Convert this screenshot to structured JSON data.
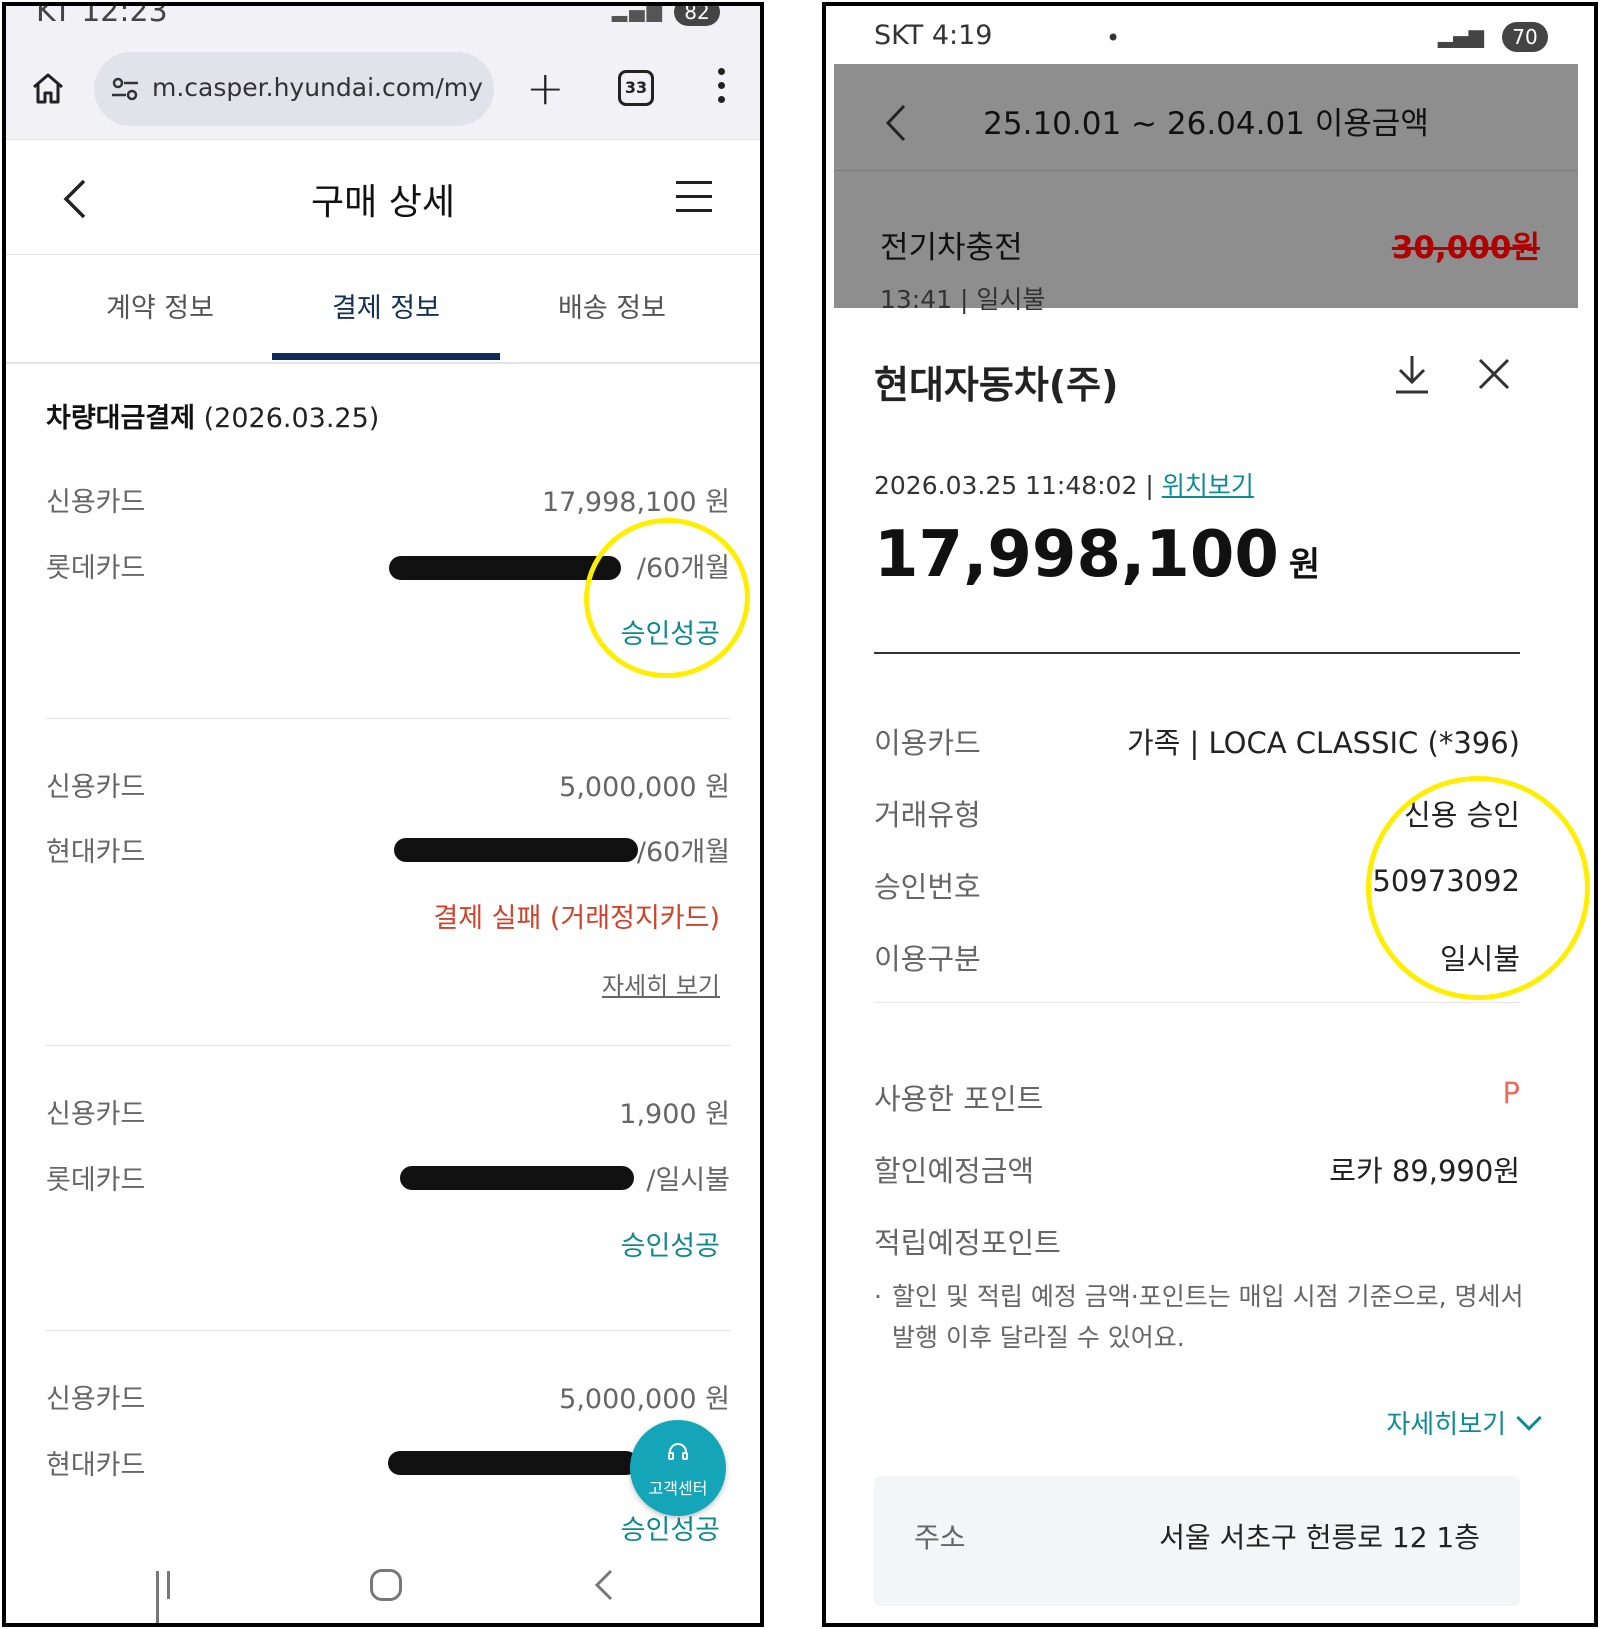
{
  "left": {
    "status": {
      "time": "KT 12:23",
      "battery": "82"
    },
    "browser": {
      "url": "m.casper.hyundai.com/mypag",
      "tab_count": "33"
    },
    "header": {
      "title": "구매 상세"
    },
    "tabs": [
      {
        "label": "계약 정보",
        "active": false
      },
      {
        "label": "결제 정보",
        "active": true
      },
      {
        "label": "배송 정보",
        "active": false
      }
    ],
    "section": {
      "title": "차량대금결제",
      "date": "(2026.03.25)"
    },
    "payments": [
      {
        "method": "신용카드",
        "amount": "17,998,100 원",
        "card": "롯데카드",
        "installment": "/60개월",
        "status": "승인성공",
        "status_type": "ok"
      },
      {
        "method": "신용카드",
        "amount": "5,000,000 원",
        "card": "현대카드",
        "installment": "/60개월",
        "status": "결제 실패 (거래정지카드)",
        "status_type": "fail",
        "detail_link": "자세히 보기"
      },
      {
        "method": "신용카드",
        "amount": "1,900 원",
        "card": "롯데카드",
        "installment": "/일시불",
        "status": "승인성공",
        "status_type": "ok"
      },
      {
        "method": "신용카드",
        "amount": "5,000,000 원",
        "card": "현대카드",
        "installment": "",
        "status": "승인성공",
        "status_type": "ok"
      }
    ],
    "fab": {
      "label": "고객센터"
    }
  },
  "right": {
    "status": {
      "carrier_time": "SKT 4:19",
      "battery": "70"
    },
    "overlay": {
      "title": "25.10.01 ~ 26.04.01 이용금액",
      "merchant": "전기차충전",
      "amount": "30,000원",
      "time": "13:41",
      "type": "일시불"
    },
    "detail": {
      "merchant": "현대자동차(주)",
      "datetime": "2026.03.25 11:48:02",
      "location_link": "위치보기",
      "amount": "17,998,100",
      "unit": "원",
      "rows": [
        {
          "label": "이용카드",
          "value": "가족 | LOCA CLASSIC (*396)"
        },
        {
          "label": "거래유형",
          "value": "신용 승인"
        },
        {
          "label": "승인번호",
          "value": "50973092"
        },
        {
          "label": "이용구분",
          "value": "일시불"
        }
      ],
      "rows2": [
        {
          "label": "사용한 포인트",
          "value": "P"
        },
        {
          "label": "할인예정금액",
          "value": "로카 89,990원"
        },
        {
          "label": "적립예정포인트",
          "value": ""
        }
      ],
      "note": "할인 및 적립 예정 금액·포인트는 매입 시점 기준으로, 명세서 발행 이후 달라질 수 있어요.",
      "more_link": "자세히보기",
      "address_label": "주소",
      "address_value": "서울 서초구 헌릉로 12 1층"
    }
  },
  "colors": {
    "ok": "#0e8a8f",
    "fail": "#d0432a",
    "tab_active": "#0c2c55",
    "highlight": "#ffee00",
    "strike_amount": "#b00000"
  }
}
